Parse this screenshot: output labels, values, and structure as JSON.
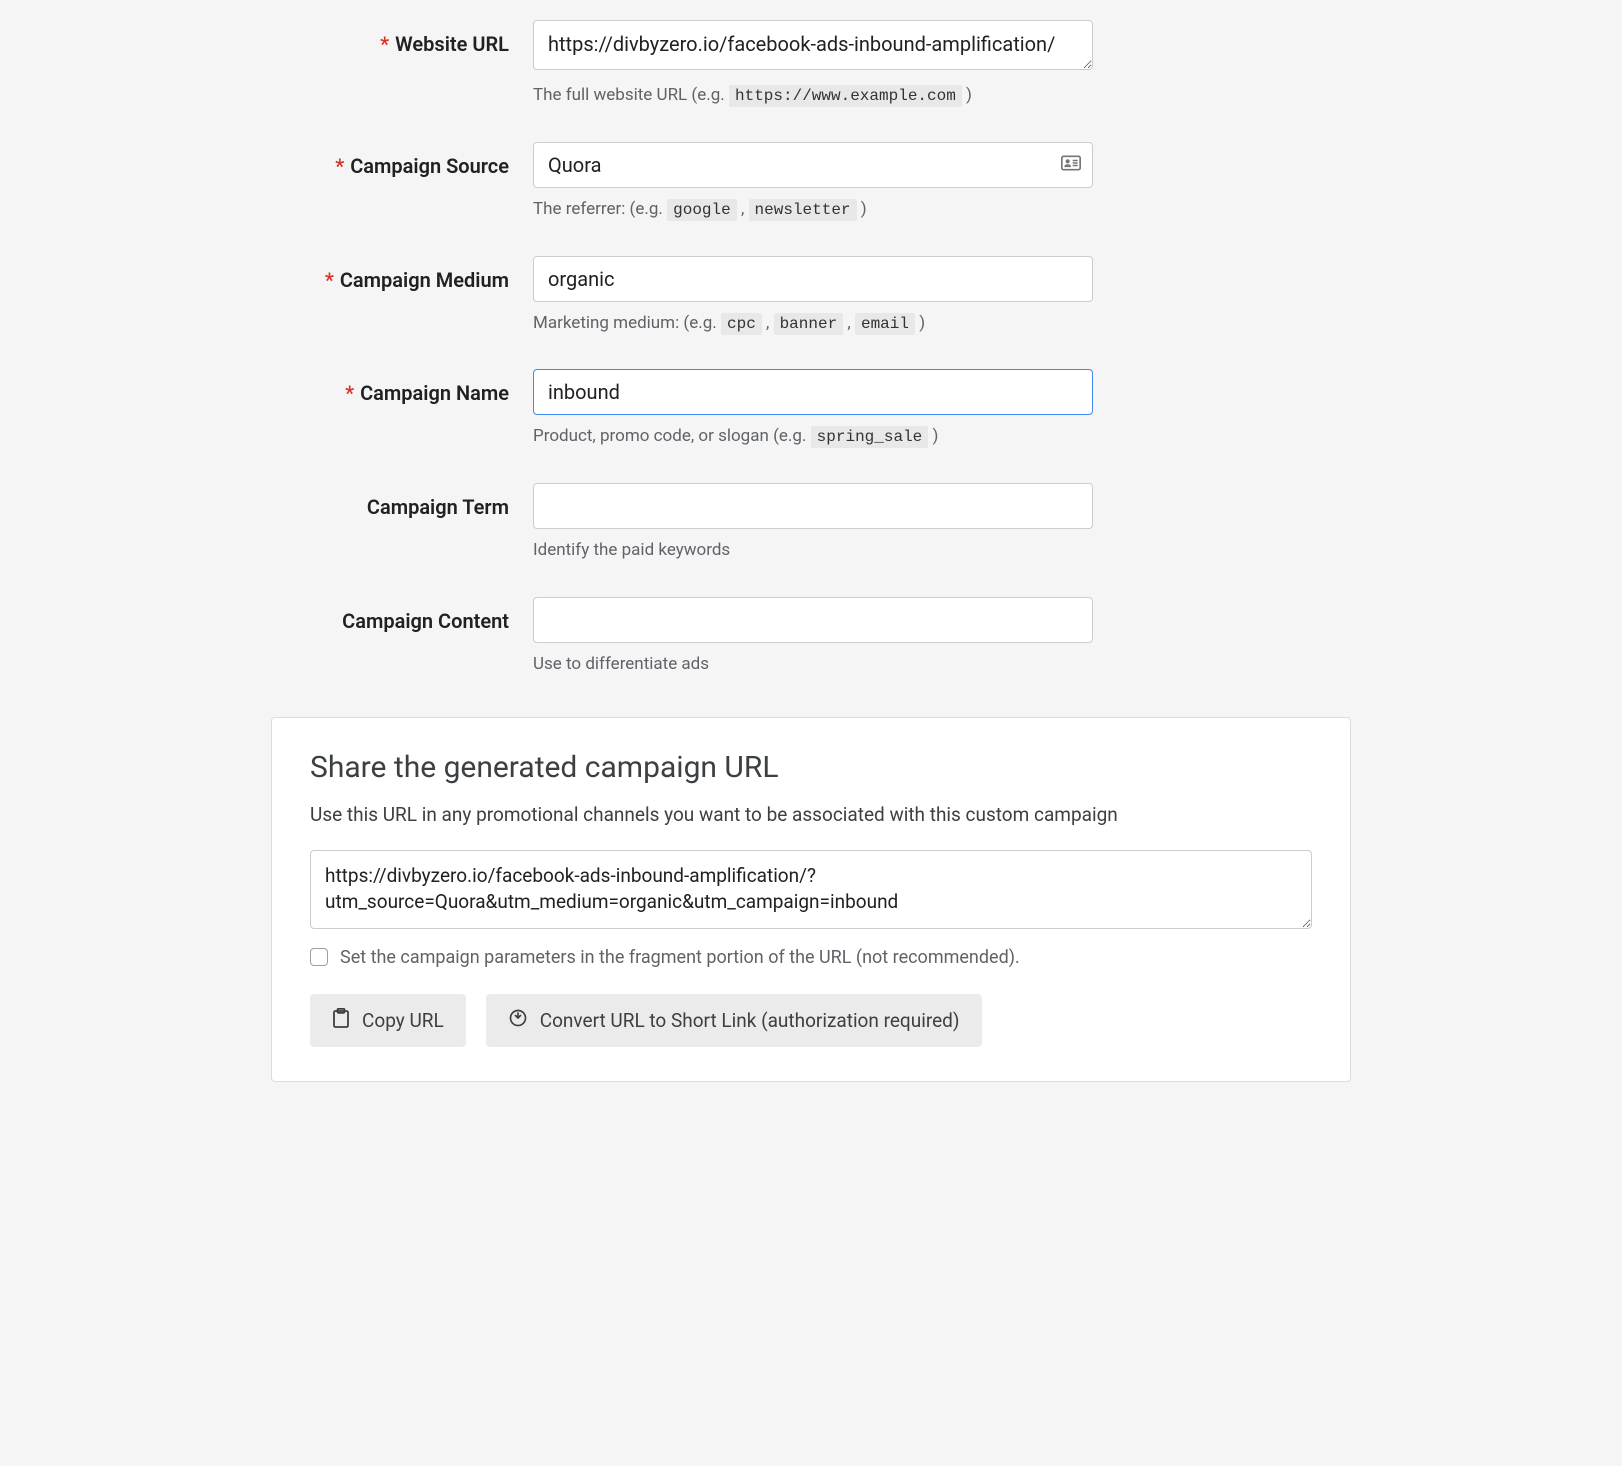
{
  "form": {
    "website_url": {
      "label": "Website URL",
      "required": true,
      "value": "https://divbyzero.io/facebook-ads-inbound-amplification/",
      "help_prefix": "The full website URL (e.g. ",
      "help_example": "https://www.example.com",
      "help_suffix": " )"
    },
    "campaign_source": {
      "label": "Campaign Source",
      "required": true,
      "value": "Quora",
      "help_prefix": "The referrer: (e.g. ",
      "help_example1": "google",
      "help_sep": " , ",
      "help_example2": "newsletter",
      "help_suffix": " )"
    },
    "campaign_medium": {
      "label": "Campaign Medium",
      "required": true,
      "value": "organic",
      "help_prefix": "Marketing medium: (e.g. ",
      "help_example1": "cpc",
      "help_sep1": " , ",
      "help_example2": "banner",
      "help_sep2": " , ",
      "help_example3": "email",
      "help_suffix": " )"
    },
    "campaign_name": {
      "label": "Campaign Name",
      "required": true,
      "value": "inbound",
      "help_prefix": "Product, promo code, or slogan (e.g. ",
      "help_example": "spring_sale",
      "help_suffix": " )"
    },
    "campaign_term": {
      "label": "Campaign Term",
      "required": false,
      "value": "",
      "help": "Identify the paid keywords"
    },
    "campaign_content": {
      "label": "Campaign Content",
      "required": false,
      "value": "",
      "help": "Use to differentiate ads"
    }
  },
  "share": {
    "title": "Share the generated campaign URL",
    "subtitle": "Use this URL in any promotional channels you want to be associated with this custom campaign",
    "generated_url": "https://divbyzero.io/facebook-ads-inbound-amplification/?utm_source=Quora&utm_medium=organic&utm_campaign=inbound",
    "fragment_checkbox_label": "Set the campaign parameters in the fragment portion of the URL (not recommended).",
    "copy_button": "Copy URL",
    "shorten_button": "Convert URL to Short Link (authorization required)"
  }
}
